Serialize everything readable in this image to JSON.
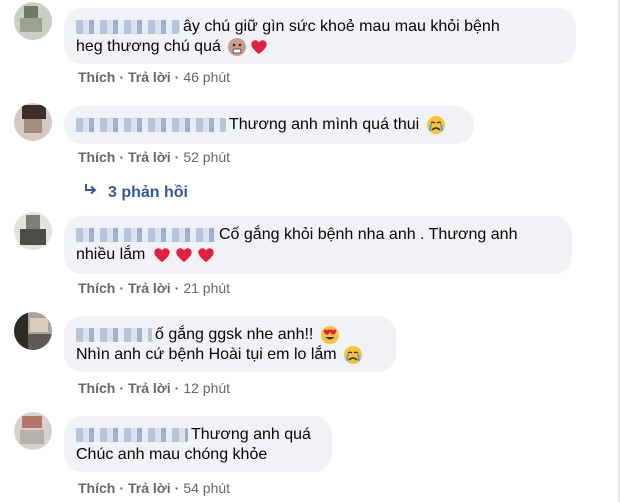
{
  "comments": [
    {
      "text_line1": "ây chú giữ gìn sức khoẻ mau mau khỏi bệnh",
      "text_line2": "heg thương chú quá",
      "like": "Thích",
      "reply": "Trả lời",
      "time": "46 phút"
    },
    {
      "text_line1": "Thương anh mình quá thui",
      "like": "Thích",
      "reply": "Trả lời",
      "time": "52 phút"
    },
    {
      "text_line1": "Cố gắng khỏi bệnh nha anh . Thương anh",
      "text_line2": "nhiều lắm",
      "like": "Thích",
      "reply": "Trả lời",
      "time": "21 phút"
    },
    {
      "text_line1": "ố gắng ggsk nhe anh!!",
      "text_line2": "Nhìn anh cứ bệnh Hoài tụi em lo lắm",
      "like": "Thích",
      "reply": "Trả lời",
      "time": "12 phút"
    },
    {
      "text_line1": "Thương anh quá",
      "text_line2": "Chúc anh mau chóng khỏe",
      "like": "Thích",
      "reply": "Trả lời",
      "time": "54 phút"
    }
  ],
  "replies_link": {
    "label": "3 phản hồi"
  },
  "colors": {
    "bubble_bg": "#f0f2f5",
    "action_text": "#65676b",
    "link_blue": "#385898",
    "heart_red": "#e41e3f",
    "emoji_yellow": "#f7c33b"
  },
  "icons": [
    "reply-arrow-icon",
    "heart-icon",
    "heart-eyes-emoji-icon",
    "crying-emoji-icon",
    "anguished-emoji-icon"
  ]
}
